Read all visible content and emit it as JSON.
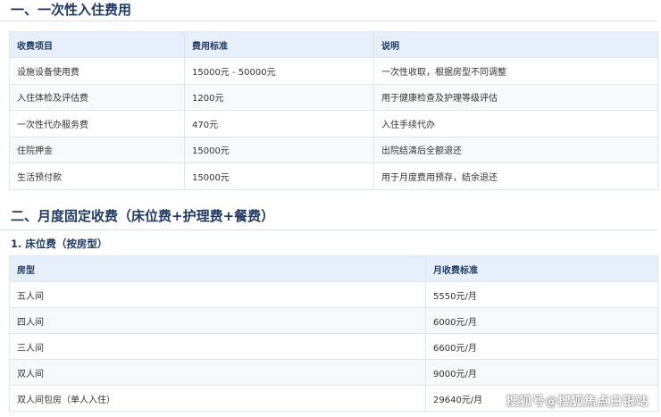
{
  "section1": {
    "title": "一、一次性入住费用",
    "headers": [
      "收费项目",
      "费用标准",
      "说明"
    ],
    "rows": [
      [
        "设施设备使用费",
        "15000元 - 50000元",
        "一次性收取，根据房型不同调整"
      ],
      [
        "入住体检及评估费",
        "1200元",
        "用于健康检查及护理等级评估"
      ],
      [
        "一次性代办服务费",
        "470元",
        "入住手续代办"
      ],
      [
        "住院押金",
        "15000元",
        "出院结清后全额退还"
      ],
      [
        "生活预付款",
        "15000元",
        "用于月度费用预存，结余退还"
      ]
    ]
  },
  "section2": {
    "title": "二、月度固定收费（床位费+护理费+餐费）",
    "subtitle": "1. 床位费（按房型）",
    "headers": [
      "房型",
      "月收费标准"
    ],
    "rows": [
      [
        "五人间",
        "5550元/月"
      ],
      [
        "四人间",
        "6000元/月"
      ],
      [
        "三人间",
        "6600元/月"
      ],
      [
        "双人间",
        "9000元/月"
      ],
      [
        "双人间包房（单人入住）",
        "29640元/月"
      ]
    ]
  },
  "watermark": "搜狐号@搜狐焦点白银站"
}
